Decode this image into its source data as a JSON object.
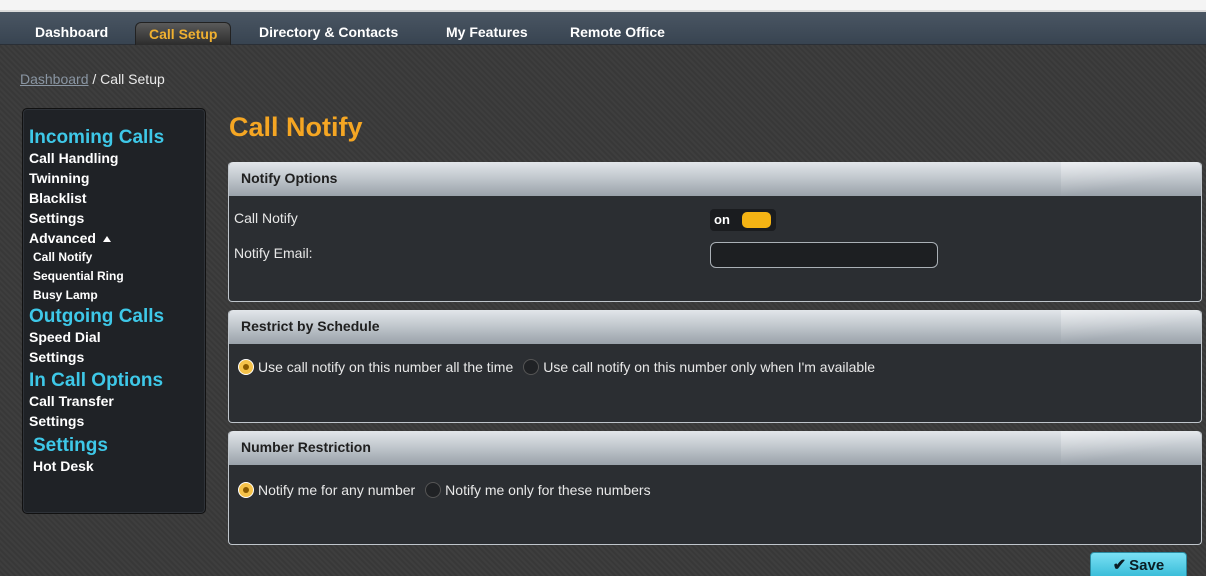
{
  "nav": {
    "tabs": [
      {
        "label": "Dashboard"
      },
      {
        "label": "Call Setup",
        "active": true
      },
      {
        "label": "Directory & Contacts"
      },
      {
        "label": "My Features"
      },
      {
        "label": "Remote Office"
      }
    ]
  },
  "breadcrumb": {
    "link": "Dashboard",
    "separator": " / ",
    "current": "Call Setup"
  },
  "sidebar": {
    "incoming": {
      "heading": "Incoming Calls",
      "items": [
        "Call Handling",
        "Twinning",
        "Blacklist",
        "Settings"
      ],
      "advanced_label": "Advanced",
      "advanced_icon": "triangle-up-icon",
      "advanced_items": [
        "Call Notify",
        "Sequential Ring",
        "Busy Lamp"
      ]
    },
    "outgoing": {
      "heading": "Outgoing Calls",
      "items": [
        "Speed Dial",
        "Settings"
      ]
    },
    "incall": {
      "heading": "In Call Options",
      "items": [
        "Call Transfer",
        "Settings"
      ]
    },
    "settings": {
      "heading": "Settings",
      "items": [
        "Hot Desk"
      ]
    }
  },
  "page": {
    "title": "Call Notify"
  },
  "notify_options": {
    "header": "Notify Options",
    "call_notify_label": "Call Notify",
    "toggle_state": "on",
    "email_label": "Notify Email:",
    "email_value": ""
  },
  "schedule": {
    "header": "Restrict by Schedule",
    "option1": "Use call notify on this number all the time",
    "option2": "Use call notify on this number only when I'm available",
    "selected": 1
  },
  "number_restriction": {
    "header": "Number Restriction",
    "option1": "Notify me for any number",
    "option2": "Notify me only for these numbers",
    "selected": 1
  },
  "save": {
    "label": "Save",
    "icon": "checkmark-icon"
  },
  "colors": {
    "accent_orange": "#f5a623",
    "sidebar_heading": "#3ec8e8",
    "toggle_on": "#f5b414",
    "save_button": "#4fc8e2"
  }
}
